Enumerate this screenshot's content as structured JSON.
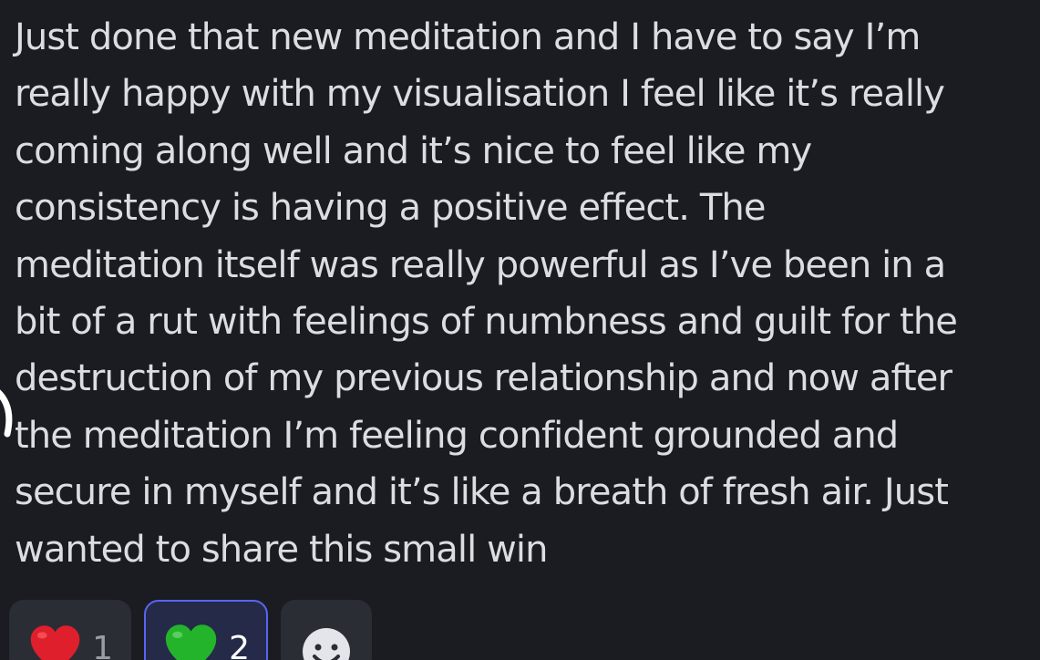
{
  "message": {
    "text": "Just done that new meditation and I have to say I’m\nreally happy with my visualisation I feel like it’s really\ncoming along well and it’s nice to feel like my\nconsistency is having a positive effect. The\nmeditation itself was really powerful as I’ve been in a\nbit of a rut with feelings of numbness and guilt for the\ndestruction of my previous relationship and now after\nthe meditation I’m feeling confident grounded and\nsecure in myself and it’s like a breath of fresh air. Just\nwanted to share this small win"
  },
  "reactions": [
    {
      "emoji": "red-heart-icon",
      "count": "1",
      "selected": false,
      "color": "#e01f2c"
    },
    {
      "emoji": "green-heart-icon",
      "count": "2",
      "selected": true,
      "color": "#23b42b"
    }
  ],
  "add_reaction": {
    "icon": "smiley-icon"
  },
  "colors": {
    "background": "#1b1c22",
    "text": "#dcdde1",
    "reaction_bg": "#2b2d35",
    "reaction_selected_border": "#5865f2"
  }
}
